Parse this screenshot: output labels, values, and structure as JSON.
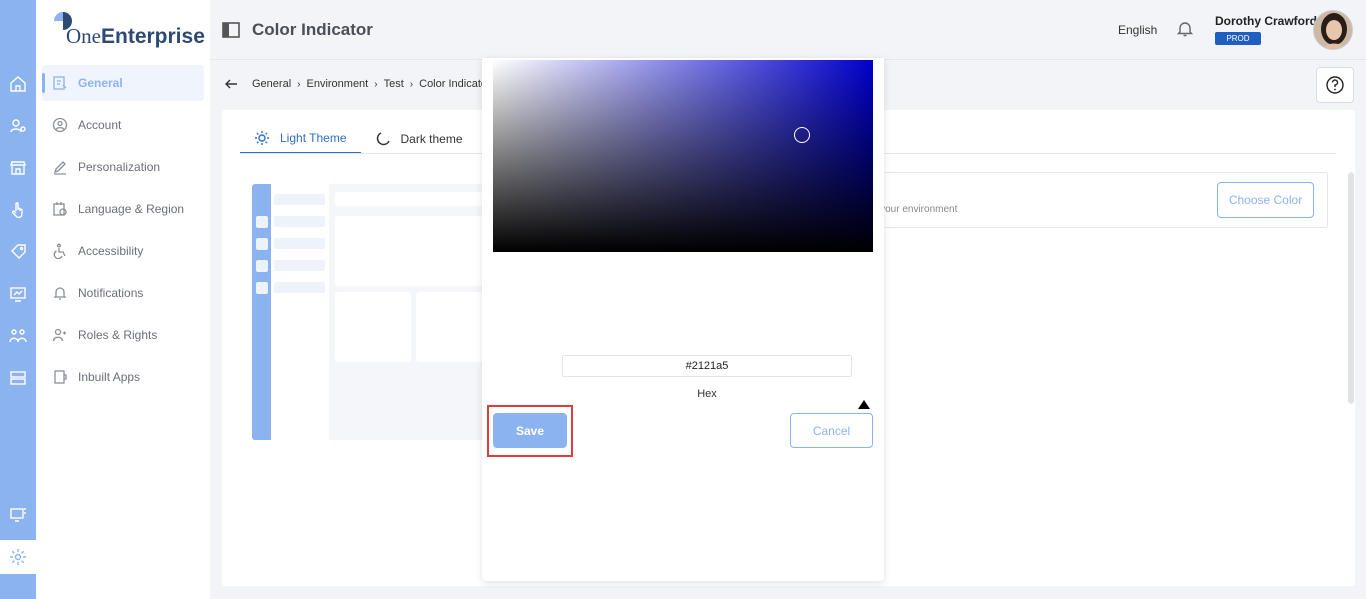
{
  "app": {
    "logo_light": "One",
    "logo_bold": "Enterprise"
  },
  "sidebar": {
    "items": [
      {
        "label": "General",
        "icon": "general-settings-icon",
        "active": true
      },
      {
        "label": "Account",
        "icon": "account-icon"
      },
      {
        "label": "Personalization",
        "icon": "pencil-icon"
      },
      {
        "label": "Language & Region",
        "icon": "language-icon"
      },
      {
        "label": "Accessibility",
        "icon": "wheelchair-icon"
      },
      {
        "label": "Notifications",
        "icon": "bell-icon"
      },
      {
        "label": "Roles & Rights",
        "icon": "roles-icon"
      },
      {
        "label": "Inbuilt Apps",
        "icon": "apps-icon"
      }
    ]
  },
  "header": {
    "title": "Color Indicator",
    "language": "English",
    "user_name": "Dorothy Crawford",
    "env_badge": "PROD"
  },
  "breadcrumb": [
    "General",
    "Environment",
    "Test",
    "Color Indicator"
  ],
  "tabs": [
    {
      "label": "Light Theme",
      "active": true
    },
    {
      "label": "Dark theme"
    }
  ],
  "color_row": {
    "description": "r your environment",
    "button": "Choose Color"
  },
  "picker": {
    "hex_value": "#2121a5",
    "hex_label": "Hex",
    "save": "Save",
    "cancel": "Cancel"
  },
  "colors": {
    "accent": "#8ab3f0",
    "primary": "#2c6fc9",
    "badge": "#1f5fbf",
    "highlight": "#e03c3c"
  }
}
